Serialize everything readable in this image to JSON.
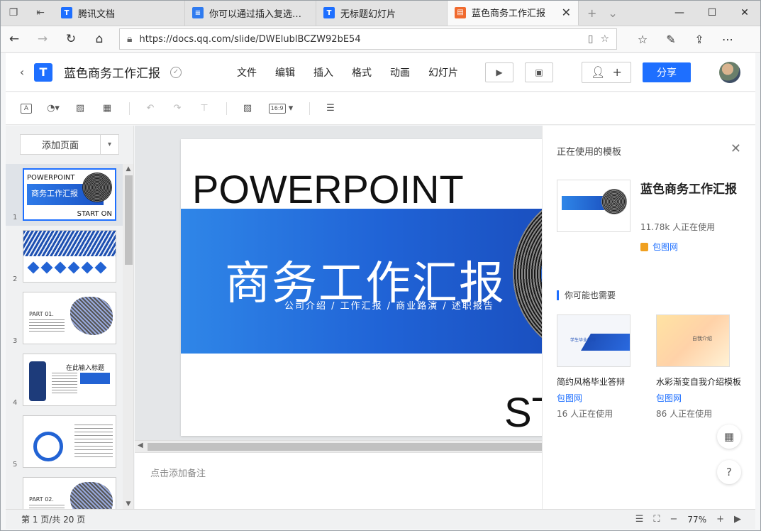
{
  "browser": {
    "tabs": [
      {
        "label": "腾讯文档",
        "icon": "tencent-docs-icon"
      },
      {
        "label": "你可以通过插入复选框来",
        "icon": "doc-icon"
      },
      {
        "label": "无标题幻灯片",
        "icon": "tencent-docs-icon"
      },
      {
        "label": "蓝色商务工作汇报",
        "icon": "slide-icon"
      }
    ],
    "url": "https://docs.qq.com/slide/DWElublBCZW92bE54"
  },
  "header": {
    "doc_title": "蓝色商务工作汇报",
    "menus": [
      "文件",
      "编辑",
      "插入",
      "格式",
      "动画",
      "幻灯片"
    ],
    "share_label": "分享"
  },
  "toolbar": {
    "ratio_label": "16:9"
  },
  "left_panel": {
    "add_page_label": "添加页面",
    "thumbs": [
      {
        "num": "1",
        "title": "POWERPOINT",
        "sub": "商务工作汇报",
        "tail": "START ON"
      },
      {
        "num": "2"
      },
      {
        "num": "3",
        "part": "PART 01."
      },
      {
        "num": "4",
        "title": "在此输入标题"
      },
      {
        "num": "5"
      },
      {
        "num": "",
        "part": "PART 02."
      }
    ]
  },
  "slide": {
    "title": "POWERPOINT",
    "main": "商务工作汇报",
    "subtitle": "公司介绍 / 工作汇报 / 商业路演 / 述职报告",
    "tail": "ST"
  },
  "notes": {
    "placeholder": "点击添加备注"
  },
  "template_panel": {
    "heading": "正在使用的模板",
    "current": {
      "name": "蓝色商务工作汇报",
      "users": "11.78k 人正在使用",
      "source": "包图网"
    },
    "recommend_heading": "你可能也需要",
    "recommendations": [
      {
        "name": "简约风格毕业答辩",
        "source": "包图网",
        "users": "16 人正在使用",
        "img_label": "学生毕业答辩"
      },
      {
        "name": "水彩渐变自我介绍模板",
        "source": "包图网",
        "users": "86 人正在使用",
        "img_label": "自我介绍"
      }
    ]
  },
  "status": {
    "page_info": "第 1 页/共 20 页",
    "zoom": "77%"
  },
  "colors": {
    "accent": "#1e6fff",
    "slide_band": "#2063d6"
  }
}
